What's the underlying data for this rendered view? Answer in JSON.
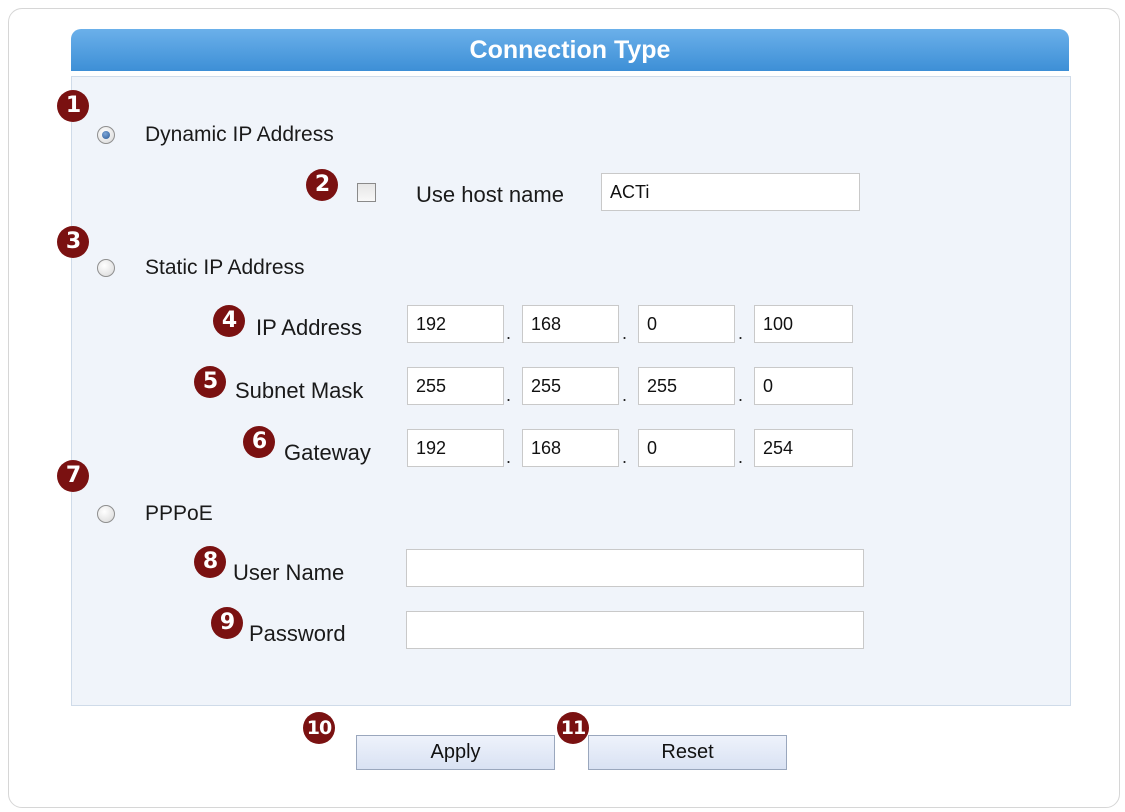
{
  "header": {
    "title": "Connection Type"
  },
  "badges": [
    "1",
    "2",
    "3",
    "4",
    "5",
    "6",
    "7",
    "8",
    "9",
    "10",
    "11"
  ],
  "dynamic_ip": {
    "label": "Dynamic IP Address",
    "selected": true,
    "use_host_name": {
      "label": "Use host name",
      "checked": false,
      "value": "ACTi"
    }
  },
  "static_ip": {
    "label": "Static IP Address",
    "selected": false,
    "ip_address": {
      "label": "IP Address",
      "octets": [
        "192",
        "168",
        "0",
        "100"
      ]
    },
    "subnet_mask": {
      "label": "Subnet Mask",
      "octets": [
        "255",
        "255",
        "255",
        "0"
      ]
    },
    "gateway": {
      "label": "Gateway",
      "octets": [
        "192",
        "168",
        "0",
        "254"
      ]
    }
  },
  "pppoe": {
    "label": "PPPoE",
    "selected": false,
    "user_name": {
      "label": "User Name",
      "value": ""
    },
    "password": {
      "label": "Password",
      "value": ""
    }
  },
  "separator": ".",
  "buttons": {
    "apply": "Apply",
    "reset": "Reset"
  },
  "colors": {
    "header_bar": "#4a9be0",
    "panel_bg": "#f0f4fa",
    "badge": "#7a1111",
    "button_bg": "#dde5f4"
  }
}
